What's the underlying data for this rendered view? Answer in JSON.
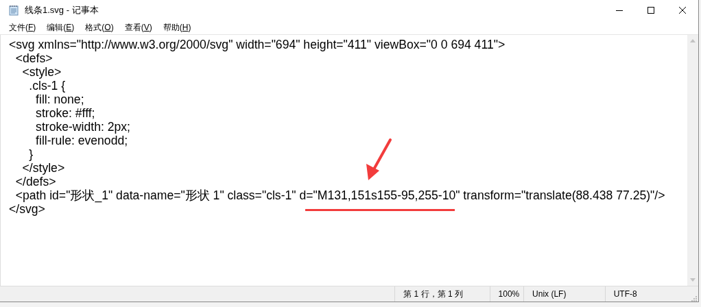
{
  "window": {
    "title": "线条1.svg - 记事本"
  },
  "menu": [
    {
      "label": "文件(",
      "hotkey": "F",
      "close": ")"
    },
    {
      "label": "编辑(",
      "hotkey": "E",
      "close": ")"
    },
    {
      "label": "格式(",
      "hotkey": "O",
      "close": ")"
    },
    {
      "label": "查看(",
      "hotkey": "V",
      "close": ")"
    },
    {
      "label": "帮助(",
      "hotkey": "H",
      "close": ")"
    }
  ],
  "editor": {
    "lines": [
      "<svg xmlns=\"http://www.w3.org/2000/svg\" width=\"694\" height=\"411\" viewBox=\"0 0 694 411\">",
      "  <defs>",
      "    <style>",
      "      .cls-1 {",
      "        fill: none;",
      "        stroke: #fff;",
      "        stroke-width: 2px;",
      "        fill-rule: evenodd;",
      "      }",
      "    </style>",
      "  </defs>",
      "  <path id=\"形状_1\" data-name=\"形状 1\" class=\"cls-1\" d=\"M131,151s155-95,255-10\" transform=\"translate(88.438 77.25)\"/>",
      "</svg>"
    ]
  },
  "status_bar": [
    "第 1 行，第 1 列",
    "100%",
    "Unix (LF)",
    "UTF-8"
  ]
}
